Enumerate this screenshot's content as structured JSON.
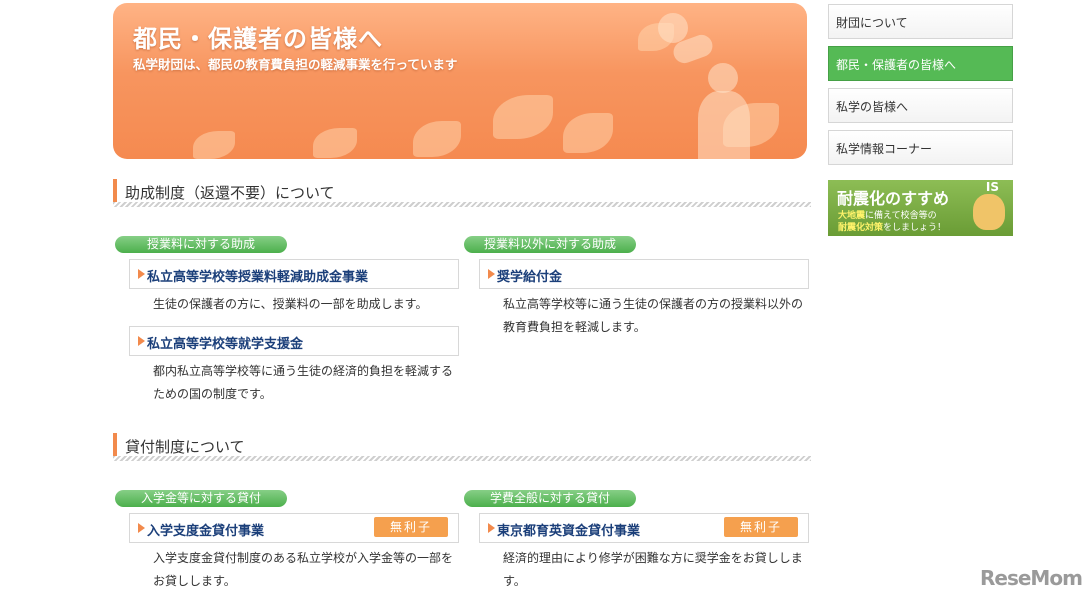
{
  "banner": {
    "title": "都民・保護者の皆様へ",
    "subtitle": "私学財団は、都民の教育費負担の軽減事業を行っています"
  },
  "sections": [
    {
      "heading": "助成制度（返還不要）について",
      "columns": [
        {
          "pill": "授業料に対する助成",
          "items": [
            {
              "label": "私立高等学校等授業料軽減助成金事業",
              "desc": "生徒の保護者の方に、授業料の一部を助成します。"
            },
            {
              "label": "私立高等学校等就学支援金",
              "desc": "都内私立高等学校等に通う生徒の経済的負担を軽減するための国の制度です。"
            }
          ]
        },
        {
          "pill": "授業料以外に対する助成",
          "items": [
            {
              "label": "奨学給付金",
              "desc": "私立高等学校等に通う生徒の保護者の方の授業料以外の教育費負担を軽減します。"
            }
          ]
        }
      ]
    },
    {
      "heading": "貸付制度について",
      "columns": [
        {
          "pill": "入学金等に対する貸付",
          "items": [
            {
              "label": "入学支度金貸付事業",
              "badge": "無利子",
              "desc": "入学支度金貸付制度のある私立学校が入学金等の一部をお貸しします。"
            }
          ]
        },
        {
          "pill": "学費全般に対する貸付",
          "items": [
            {
              "label": "東京都育英資金貸付事業",
              "badge": "無利子",
              "desc": "経済的理由により修学が困難な方に奨学金をお貸しします。"
            }
          ]
        }
      ]
    }
  ],
  "sidebar": {
    "nav": [
      "財団について",
      "都民・保護者の皆様へ",
      "私学の皆様へ",
      "私学情報コーナー"
    ],
    "active_index": 1,
    "promo": {
      "title": "耐震化のすすめ",
      "line1_highlight": "大地震",
      "line1": "に備えて校舎等の",
      "line2_highlight": "耐震化対策",
      "line2": "をしましょう！",
      "mascot_text": "IS"
    }
  },
  "watermark": "ReseMom",
  "colors": {
    "accent": "#f28a4c",
    "green": "#4caf4c",
    "link": "#1b3f7a"
  }
}
